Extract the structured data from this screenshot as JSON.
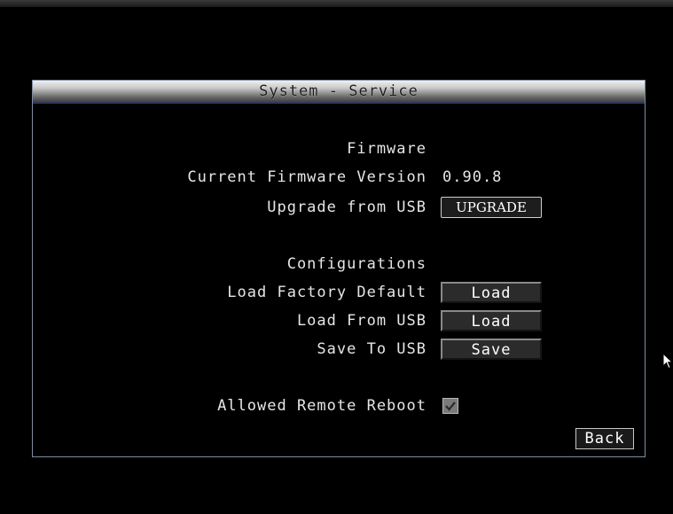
{
  "dialog": {
    "title": "System - Service"
  },
  "firmware": {
    "section_label": "Firmware",
    "current_version_label": "Current Firmware Version",
    "current_version_value": "0.90.8",
    "upgrade_label": "Upgrade from USB",
    "upgrade_button": "UPGRADE"
  },
  "configurations": {
    "section_label": "Configurations",
    "factory_default_label": "Load Factory Default",
    "factory_default_button": "Load",
    "load_usb_label": "Load From USB",
    "load_usb_button": "Load",
    "save_usb_label": "Save To USB",
    "save_usb_button": "Save"
  },
  "remote_reboot": {
    "label": "Allowed Remote Reboot",
    "checked": true
  },
  "back_button": "Back",
  "colors": {
    "background": "#000000",
    "text": "#e6e6e6",
    "border": "#7f8da0"
  },
  "icons": {
    "checkbox": "checkmark-icon",
    "pointer": "mouse-pointer-icon"
  }
}
